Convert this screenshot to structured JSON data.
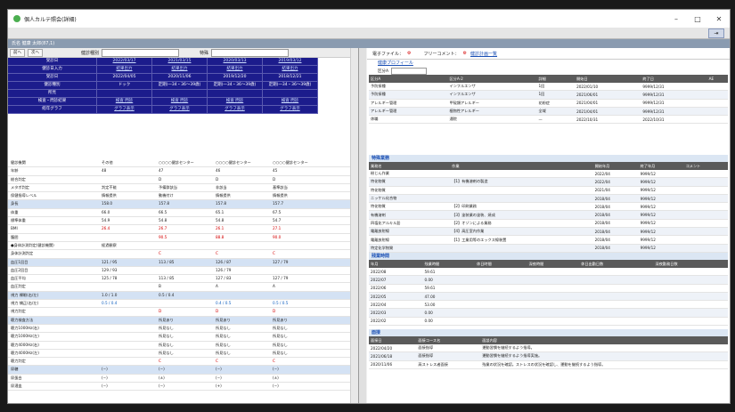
{
  "window": {
    "title": "個人カルテ照会(詳細)",
    "minimize": "–",
    "maximize": "□",
    "close": "✕"
  },
  "crumb": "氏名 健康 太郎(87,1)",
  "toolbar": {
    "prev": "前へ",
    "next": "次へ",
    "kind_label": "健診種別",
    "special_label": "特殊"
  },
  "header_labels": [
    "受診日",
    "健診日入力",
    "受診日",
    "健診種別",
    "所見",
    "検査・問診結果",
    "経年グラフ"
  ],
  "columns": [
    {
      "date": "2022/03/17",
      "input": "結果出力",
      "jdate": "2022/04/05",
      "kind": "ドック",
      "shoken": "",
      "kensa": "検査 問診",
      "graph": "グラフ表示"
    },
    {
      "date": "2021/03/15",
      "input": "結果出力",
      "jdate": "2020/11/06",
      "kind": "定期(一34・36〜39歳)",
      "shoken": "",
      "kensa": "検査 問診",
      "graph": "グラフ表示"
    },
    {
      "date": "2020/03/13",
      "input": "結果出力",
      "jdate": "2019/12/20",
      "kind": "定期(一34・36〜39歳)",
      "shoken": "",
      "kensa": "検査 問診",
      "graph": "グラフ表示"
    },
    {
      "date": "2019/03/12",
      "input": "結果出力",
      "jdate": "2018/12/21",
      "kind": "定期(一34・36〜39歳)",
      "shoken": "",
      "kensa": "検査 問診",
      "graph": "グラフ表示"
    }
  ],
  "rows": [
    {
      "label": "健診機関",
      "vals": [
        "その他",
        "○○○○健診センター",
        "○○○○健診センター",
        "○○○○健診センター"
      ],
      "cls": ""
    },
    {
      "label": "年齢",
      "vals": [
        "48",
        "47",
        "46",
        "45"
      ],
      "cls": ""
    },
    {
      "label": "総合判定",
      "vals": [
        "",
        "D",
        "D",
        "D"
      ],
      "cls": ""
    },
    {
      "label": "メタボ判定",
      "vals": [
        "判定不能",
        "予備群該当",
        "非該当",
        "基準該当"
      ],
      "cls": ""
    },
    {
      "label": "保健指導レベル",
      "vals": [
        "情報提供",
        "動機付け",
        "情報提供",
        "情報提供"
      ],
      "cls": ""
    },
    {
      "label": "身長",
      "vals": [
        "158.0",
        "157.8",
        "157.8",
        "157.7"
      ],
      "cls": "sec"
    },
    {
      "label": "体重",
      "vals": [
        "66.0",
        "66.5",
        "65.1",
        "67.5"
      ],
      "cls": ""
    },
    {
      "label": "標準体重",
      "vals": [
        "54.9",
        "54.8",
        "54.8",
        "54.7"
      ],
      "cls": ""
    },
    {
      "label": "BMI",
      "vals": [
        "26.4",
        "26.7",
        "26.1",
        "27.1"
      ],
      "cls": "red"
    },
    {
      "label": "腹囲",
      "vals": [
        "",
        "90.5",
        "88.8",
        "90.0"
      ],
      "cls": "red"
    },
    {
      "label": "●身体計測判定(健診機関)",
      "vals": [
        "経過観察",
        "",
        "",
        ""
      ],
      "cls": ""
    },
    {
      "label": "身体計測判定",
      "vals": [
        "",
        "C",
        "C",
        "C"
      ],
      "cls": "red"
    },
    {
      "label": "血圧1回目",
      "vals": [
        "121 / 95",
        "113 / 85",
        "126 / 87",
        "127 / 79"
      ],
      "cls": "sec"
    },
    {
      "label": "血圧2回目",
      "vals": [
        "129 / 93",
        "",
        "126 / 79",
        ""
      ],
      "cls": ""
    },
    {
      "label": "血圧平均",
      "vals": [
        "125 / 78",
        "113 / 85",
        "127 / 83",
        "127 / 79"
      ],
      "cls": ""
    },
    {
      "label": "血圧判定",
      "vals": [
        "",
        "B",
        "A",
        "A"
      ],
      "cls": ""
    },
    {
      "label": "視力 裸眼(右/左)",
      "vals": [
        "1.0 / 1.0",
        "0.5 / 0.4",
        "",
        ""
      ],
      "cls": "sec"
    },
    {
      "label": "視力 矯正(右/左)",
      "vals": [
        "0.5 / 0.4",
        "",
        "0.4 / 0.5",
        "0.5 / 0.5"
      ],
      "cls": "blue"
    },
    {
      "label": "視力判定",
      "vals": [
        "",
        "D",
        "D",
        "D"
      ],
      "cls": "red"
    },
    {
      "label": "聴力検査方法",
      "vals": [
        "",
        "所見あり",
        "所見あり",
        "所見あり"
      ],
      "cls": "sec"
    },
    {
      "label": "聴力1000Hz(右)",
      "vals": [
        "",
        "所見なし",
        "所見なし",
        "所見なし"
      ],
      "cls": ""
    },
    {
      "label": "聴力1000Hz(左)",
      "vals": [
        "",
        "所見なし",
        "所見なし",
        "所見なし"
      ],
      "cls": ""
    },
    {
      "label": "聴力4000Hz(右)",
      "vals": [
        "",
        "所見なし",
        "所見なし",
        "所見なし"
      ],
      "cls": ""
    },
    {
      "label": "聴力4000Hz(左)",
      "vals": [
        "",
        "所見なし",
        "所見なし",
        "所見なし"
      ],
      "cls": ""
    },
    {
      "label": "聴力判定",
      "vals": [
        "",
        "C",
        "C",
        "C"
      ],
      "cls": "red"
    },
    {
      "label": "尿糖",
      "vals": [
        "(−)",
        "(−)",
        "(−)",
        "(−)"
      ],
      "cls": "sec"
    },
    {
      "label": "尿蛋白",
      "vals": [
        "(−)",
        "(±)",
        "(−)",
        "(±)"
      ],
      "cls": ""
    },
    {
      "label": "尿潜血",
      "vals": [
        "(−)",
        "(−)",
        "(+)",
        "(−)"
      ],
      "cls": ""
    }
  ],
  "right_top": {
    "file_label": "電子ファイル：",
    "free_label": "フリーコメント：",
    "link": "健診計画一覧"
  },
  "kenko_profile": {
    "title": "健康プロフィール",
    "filter_label": "区分A",
    "headers": [
      "区分A",
      "区分A-2",
      "詳細",
      "開始日",
      "終了日",
      "AE"
    ],
    "rows": [
      [
        "予防接種",
        "インフルエンザ",
        "1回",
        "2022/01/10",
        "9999/12/31",
        ""
      ],
      [
        "予防接種",
        "インフルエンザ",
        "1回",
        "2021/06/01",
        "9999/12/31",
        ""
      ],
      [
        "アレルギー管理",
        "甲殻類アレルギー",
        "花粉症",
        "2021/04/01",
        "9999/12/31",
        ""
      ],
      [
        "アレルギー管理",
        "植物性アレルギー",
        "全域",
        "2021/04/01",
        "9999/12/31",
        ""
      ],
      [
        "休職",
        "通院",
        "—",
        "2022/10/31",
        "2022/10/31",
        ""
      ]
    ]
  },
  "tokushu": {
    "title": "特殊業務",
    "headers": [
      "業務名",
      "作業",
      "開始年月",
      "終了年月",
      "コメント"
    ],
    "rows": [
      [
        "粉じん作業",
        "",
        "2022/04",
        "9999/12",
        ""
      ],
      [
        "特化物質",
        "【1】有機溶剤の製造",
        "2022/04",
        "9999/12",
        ""
      ],
      [
        "特化物質",
        "",
        "2021/04",
        "9999/12",
        ""
      ],
      [
        "ニッケル化合物",
        "",
        "2018/04",
        "9999/12",
        ""
      ],
      [
        "特化物質",
        "【2】印刷業務",
        "2018/04",
        "9999/12",
        ""
      ],
      [
        "有機溶剤",
        "【3】塗装業の塗装、焼成",
        "2018/04",
        "9999/12",
        ""
      ],
      [
        "四塩化アルキル鉛",
        "【2】オゾンによる業務",
        "2018/04",
        "9999/12",
        ""
      ],
      [
        "電離放射線",
        "【4】高圧室内作業",
        "2018/04",
        "9999/12",
        ""
      ],
      [
        "電離放射線",
        "【1】工業用等のエックス線装置",
        "2018/04",
        "9999/12",
        ""
      ],
      [
        "特定化学物質",
        "",
        "2018/04",
        "9999/12",
        ""
      ]
    ]
  },
  "zangyo": {
    "title": "残業時間",
    "headers": [
      "年月",
      "残業時間",
      "休日時間",
      "深夜時間",
      "休日出勤日数",
      "深夜勤務日数"
    ],
    "rows": [
      [
        "2022/08",
        "59.61",
        "",
        "",
        "",
        ""
      ],
      [
        "2022/07",
        "0.00",
        "",
        "",
        "",
        ""
      ],
      [
        "2022/06",
        "59.61",
        "",
        "",
        "",
        ""
      ],
      [
        "2022/05",
        "47.00",
        "",
        "",
        "",
        ""
      ],
      [
        "2022/04",
        "53.00",
        "",
        "",
        "",
        ""
      ],
      [
        "2022/03",
        "0.00",
        "",
        "",
        "",
        ""
      ],
      [
        "2022/02",
        "0.00",
        "",
        "",
        "",
        ""
      ]
    ]
  },
  "menkai": {
    "title": "面接",
    "headers": [
      "面接日",
      "面接コース名",
      "面談内容"
    ],
    "rows": [
      [
        "2022/04/20",
        "面接指導",
        "運動習慣を継続するよう指導。"
      ],
      [
        "2021/06/18",
        "面接指導",
        "運動習慣を継続するよう指導実施。"
      ],
      [
        "2020/11/06",
        "高ストレス者面接",
        "残業の状況を確認。ストレスの状況を確認し、運動を継続するよう指導。"
      ]
    ]
  }
}
